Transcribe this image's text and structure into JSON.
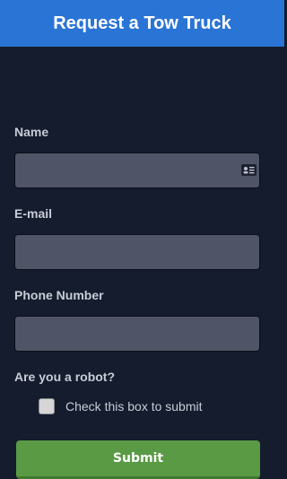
{
  "header": {
    "title": "Request a Tow Truck"
  },
  "form": {
    "name_label": "Name",
    "name_value": "",
    "email_label": "E-mail",
    "email_value": "",
    "phone_label": "Phone Number",
    "phone_value": "",
    "robot_label": "Are you a robot?",
    "checkbox_label": "Check this box to submit",
    "checkbox_checked": false,
    "submit_label": "Submit"
  },
  "colors": {
    "header_bg": "#2a74d6",
    "page_bg": "#141c2e",
    "field_bg": "#4f5466",
    "submit_bg": "#5a9a45"
  },
  "icons": {
    "name_field_icon": "contact-card-icon"
  }
}
